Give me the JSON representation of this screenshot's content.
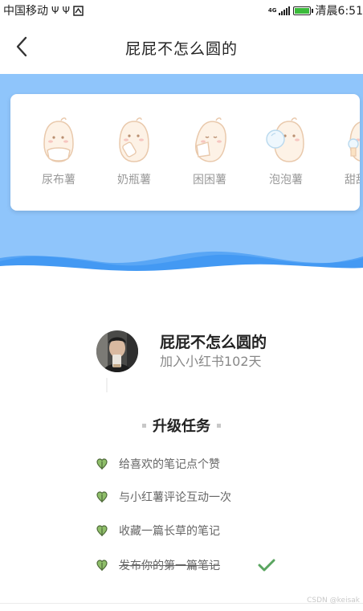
{
  "status_bar": {
    "carrier": "中国移动",
    "usb_icon_1": "usb-icon",
    "usb_icon_2": "usb-icon",
    "app_icon": "notification-icon",
    "network": "4G",
    "signal_icon": "signal-icon",
    "battery_icon": "battery-charging-icon",
    "time": "清晨6:51"
  },
  "nav": {
    "back_icon": "chevron-left-icon",
    "title": "屁屁不怎么圆的"
  },
  "stickers": [
    {
      "label": "尿布薯",
      "icon": "potato-diaper-icon"
    },
    {
      "label": "奶瓶薯",
      "icon": "potato-bottle-icon"
    },
    {
      "label": "困困薯",
      "icon": "potato-sleepy-icon"
    },
    {
      "label": "泡泡薯",
      "icon": "potato-bubble-icon"
    },
    {
      "label": "甜甜薯",
      "icon": "potato-sweet-icon"
    }
  ],
  "profile": {
    "name": "屁屁不怎么圆的",
    "days_joined": "加入小红书102天"
  },
  "tasks_section": {
    "title": "升级任务",
    "tasks": [
      {
        "label": "给喜欢的笔记点个赞",
        "done": false
      },
      {
        "label": "与小红薯评论互动一次",
        "done": false
      },
      {
        "label": "收藏一篇长草的笔记",
        "done": false
      },
      {
        "label": "发布你的第一篇笔记",
        "done": true
      }
    ]
  },
  "watermark": "CSDN @keisak",
  "colors": {
    "band_blue": "#8fc5fb",
    "wave_blue": "#2e8cf0",
    "check_green": "#5aa560",
    "heart_green": "#8fbf6a"
  }
}
